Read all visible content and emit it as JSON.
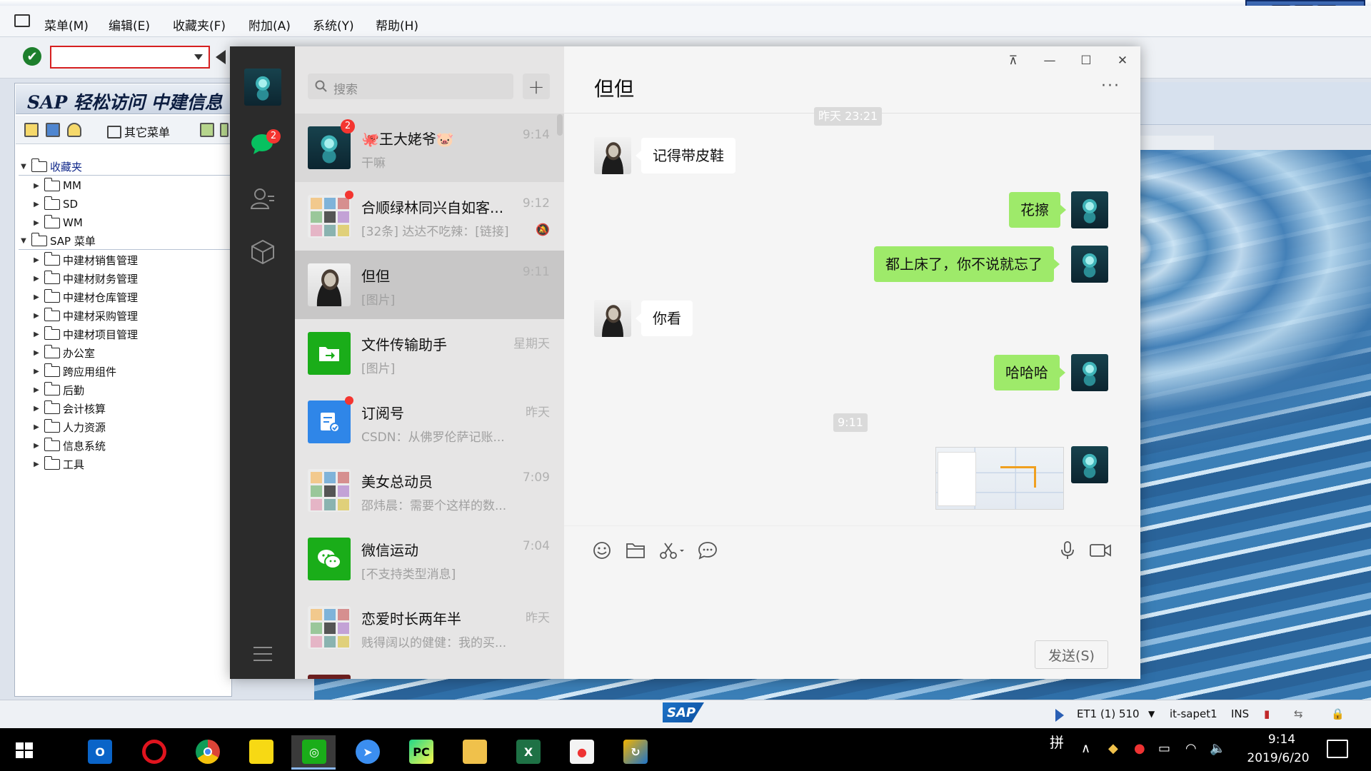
{
  "sap": {
    "menu": [
      "菜单(M)",
      "编辑(E)",
      "收藏夹(F)",
      "附加(A)",
      "系统(Y)",
      "帮助(H)"
    ],
    "title": "SAP 轻松访问 中建信息",
    "other_menu": "其它菜单",
    "tree_favorites": "收藏夹",
    "favorites": [
      "MM",
      "SD",
      "WM"
    ],
    "tree_sap_menu": "SAP 菜单",
    "sap_menu": [
      "中建材销售管理",
      "中建材财务管理",
      "中建材仓库管理",
      "中建材采购管理",
      "中建材项目管理",
      "办公室",
      "跨应用组件",
      "后勤",
      "会计核算",
      "人力资源",
      "信息系统",
      "工具"
    ],
    "status": {
      "logo": "SAP",
      "system": "ET1 (1) 510",
      "server": "it-sapet1",
      "mode": "INS"
    }
  },
  "wechat": {
    "search_placeholder": "搜索",
    "add_icon": "+",
    "chats": [
      {
        "name": "🐙王大姥爷🐷",
        "time": "9:14",
        "preview": "干嘛",
        "avatar": "jelly",
        "badge": "2"
      },
      {
        "name": "合顺绿林同兴自如客...",
        "time": "9:12",
        "preview": "[32条] 达达不吃辣：[链接]",
        "avatar": "group",
        "dot": true,
        "muted": true
      },
      {
        "name": "但但",
        "time": "9:11",
        "preview": "[图片]",
        "avatar": "man",
        "active": true
      },
      {
        "name": "文件传输助手",
        "time": "星期天",
        "preview": "[图片]",
        "avatar": "green"
      },
      {
        "name": "订阅号",
        "time": "昨天",
        "preview": "CSDN：从佛罗伦萨记账...",
        "avatar": "blue",
        "dot": true
      },
      {
        "name": "美女总动员",
        "time": "7:09",
        "preview": "邵炜晨：需要个这样的数...",
        "avatar": "group"
      },
      {
        "name": "微信运动",
        "time": "7:04",
        "preview": "[不支持类型消息]",
        "avatar": "green"
      },
      {
        "name": "恋爱时长两年半",
        "time": "昨天",
        "preview": "贱得阔以的健健：我的买...",
        "avatar": "group"
      }
    ],
    "nav_badge": "2",
    "conversation": {
      "title": "但但",
      "more": "···",
      "top_timestamp": "昨天 23:21",
      "messages": [
        {
          "side": "in",
          "text": "记得带皮鞋"
        },
        {
          "side": "out",
          "text": "花擦"
        },
        {
          "side": "out",
          "text": "都上床了，你不说就忘了"
        },
        {
          "side": "in",
          "text": "你看"
        },
        {
          "side": "out",
          "text": "哈哈哈"
        }
      ],
      "timestamp_2": "9:11",
      "send_label": "发送(S)"
    },
    "window_buttons": {
      "pin": "⊼",
      "minimize": "—",
      "maximize": "☐",
      "close": "✕"
    }
  },
  "taskbar": {
    "apps": [
      "outlook",
      "opera",
      "chrome",
      "sticky-notes",
      "wechat",
      "feishu",
      "pycharm",
      "file-explorer",
      "excel",
      "maps",
      "sap-logon"
    ],
    "ime": "拼",
    "time": "9:14",
    "date": "2019/6/20"
  },
  "colors": {
    "wechat_green": "#9eea6a",
    "badge_red": "#f43530",
    "sidebar_dark": "#2b2b2b"
  }
}
